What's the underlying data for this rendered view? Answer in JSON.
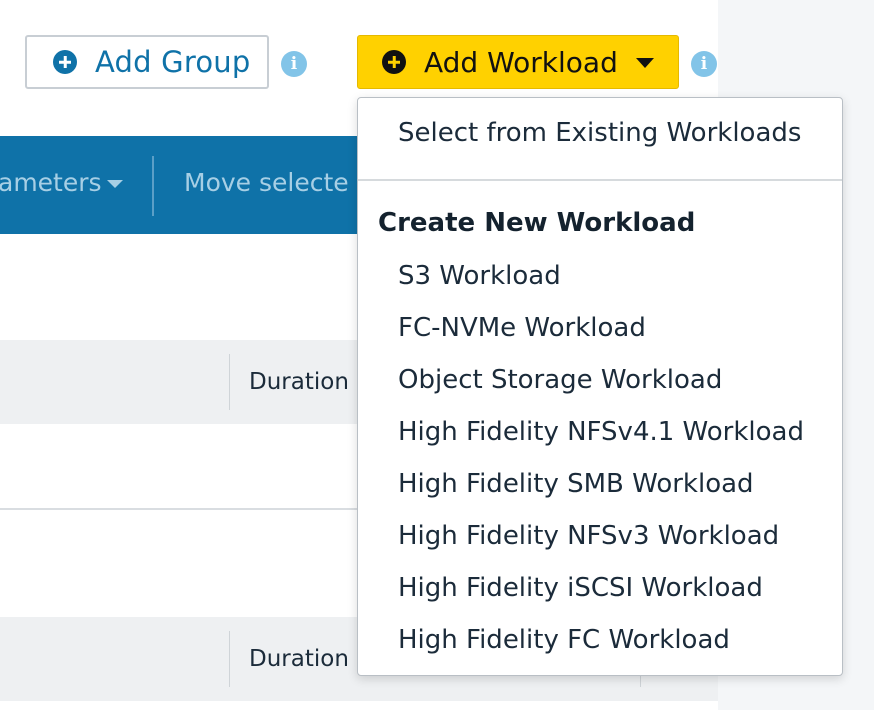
{
  "toolbar": {
    "add_group_label": "Add Group",
    "add_workload_label": "Add Workload",
    "info_glyph": "i"
  },
  "blue_bar": {
    "parameters_label": "ameters",
    "move_selected_label": "Move selecte"
  },
  "table": {
    "duration_header_1": "Duration",
    "duration_header_2": "Duration"
  },
  "dropdown": {
    "select_existing": "Select from Existing Workloads",
    "section_header": "Create New Workload",
    "items": [
      "S3 Workload",
      "FC-NVMe Workload",
      "Object Storage Workload",
      "High Fidelity NFSv4.1 Workload",
      "High Fidelity SMB Workload",
      "High Fidelity NFSv3 Workload",
      "High Fidelity iSCSI Workload",
      "High Fidelity FC Workload"
    ]
  },
  "colors": {
    "primary_blue": "#0f72a8",
    "accent_yellow": "#ffd100",
    "info_light_blue": "#82c4e8"
  }
}
